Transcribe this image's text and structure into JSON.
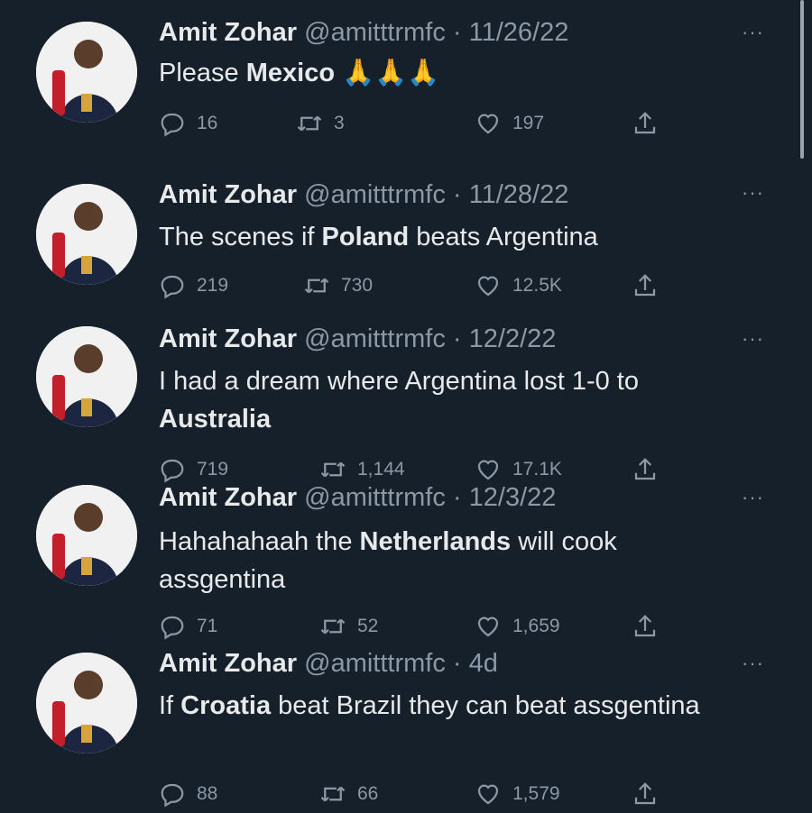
{
  "tweets": [
    {
      "name": "Amit Zohar",
      "handle": "@amitttrmfc",
      "dot": "·",
      "date": "11/26/22",
      "text_before": "Please ",
      "bold": "Mexico",
      "text_after": " 🙏🙏🙏",
      "replies": "16",
      "retweets": "3",
      "likes": "197"
    },
    {
      "name": "Amit Zohar",
      "handle": "@amitttrmfc",
      "dot": "·",
      "date": "11/28/22",
      "text_before": "The scenes if ",
      "bold": "Poland",
      "text_after": " beats Argentina",
      "replies": "219",
      "retweets": "730",
      "likes": "12.5K"
    },
    {
      "name": "Amit Zohar",
      "handle": "@amitttrmfc",
      "dot": "·",
      "date": "12/2/22",
      "text_before": "I had a dream where Argentina lost 1-0 to ",
      "bold": "Australia",
      "text_after": "",
      "replies": "719",
      "retweets": "1,144",
      "likes": "17.1K"
    },
    {
      "name": "Amit Zohar",
      "handle": "@amitttrmfc",
      "dot": "·",
      "date": "12/3/22",
      "text_before": "Hahahahaah the ",
      "bold": "Netherlands",
      "text_after": " will cook assgentina",
      "replies": "71",
      "retweets": "52",
      "likes": "1,659"
    },
    {
      "name": "Amit Zohar",
      "handle": "@amitttrmfc",
      "dot": "·",
      "date": "4d",
      "text_before": "If ",
      "bold": "Croatia",
      "text_after": " beat Brazil they can beat assgentina",
      "replies": "88",
      "retweets": "66",
      "likes": "1,579"
    }
  ],
  "more_label": "···",
  "icons": {
    "reply": "reply-icon",
    "retweet": "retweet-icon",
    "like": "heart-icon",
    "share": "share-icon",
    "more": "more-icon"
  },
  "colors": {
    "background": "#15202b",
    "text": "#e7e9ea",
    "muted": "#8b98a5"
  }
}
